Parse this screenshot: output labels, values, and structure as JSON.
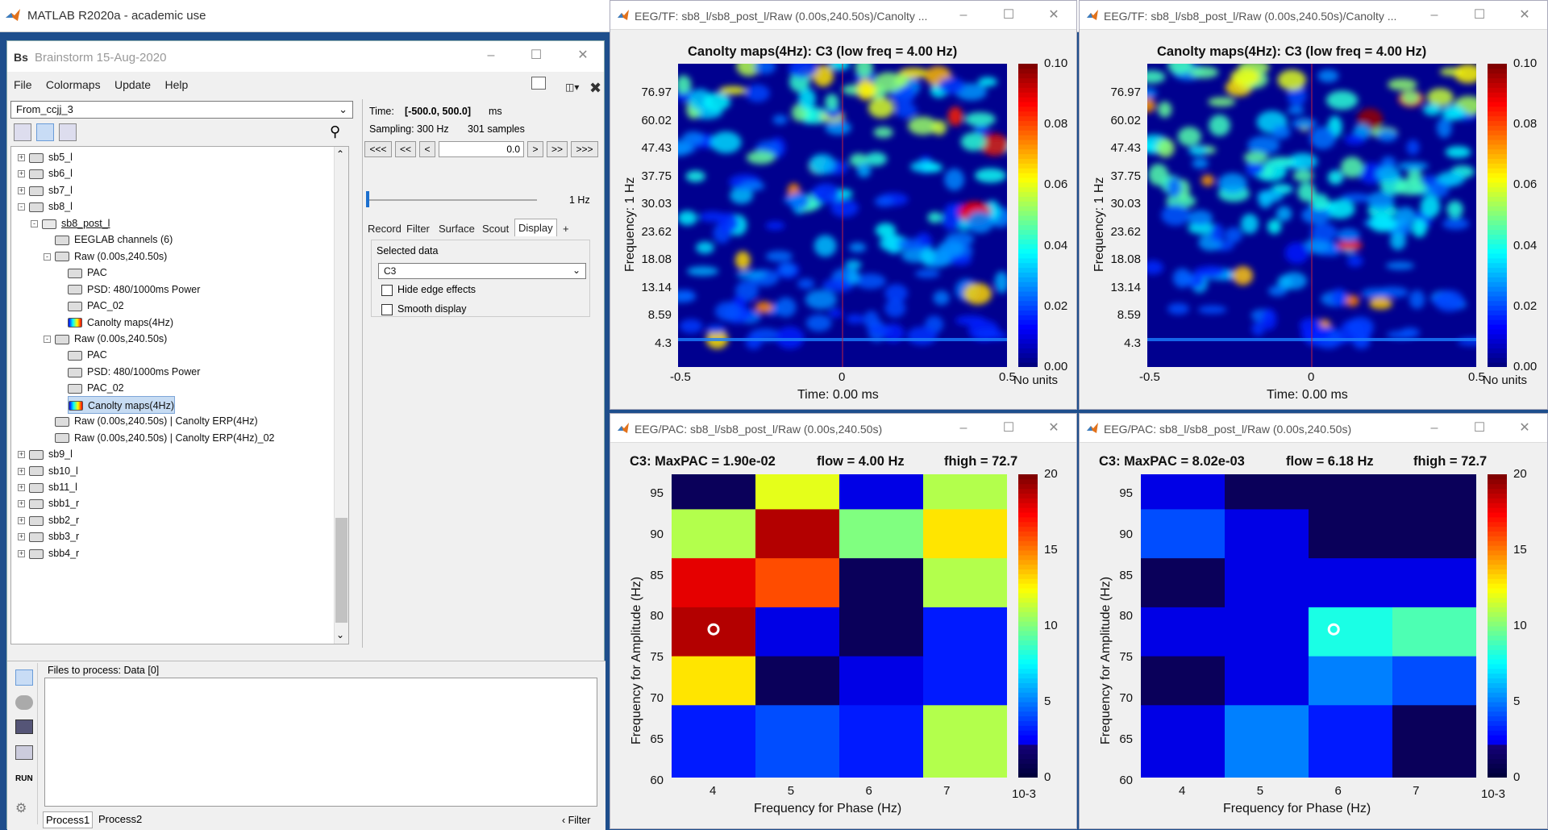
{
  "matlab_title": "MATLAB R2020a - academic use",
  "bst": {
    "title": "Brainstorm 15-Aug-2020",
    "menu": [
      "File",
      "Colormaps",
      "Update",
      "Help"
    ],
    "protocol": "From_ccjj_3",
    "tree": [
      {
        "label": "sb5_l",
        "level": 0,
        "exp": "+"
      },
      {
        "label": "sb6_l",
        "level": 0,
        "exp": "+"
      },
      {
        "label": "sb7_l",
        "level": 0,
        "exp": "+"
      },
      {
        "label": "sb8_l",
        "level": 0,
        "exp": "-"
      },
      {
        "label": "sb8_post_l",
        "level": 1,
        "exp": "-"
      },
      {
        "label": "EEGLAB channels (6)",
        "level": 2,
        "exp": ""
      },
      {
        "label": "Raw (0.00s,240.50s)",
        "level": 2,
        "exp": "-"
      },
      {
        "label": "PAC",
        "level": 3,
        "exp": ""
      },
      {
        "label": "PSD: 480/1000ms Power",
        "level": 3,
        "exp": ""
      },
      {
        "label": "PAC_02",
        "level": 3,
        "exp": ""
      },
      {
        "label": "Canolty maps(4Hz)",
        "level": 3,
        "exp": ""
      },
      {
        "label": "Raw (0.00s,240.50s)",
        "level": 2,
        "exp": "-"
      },
      {
        "label": "PAC",
        "level": 3,
        "exp": ""
      },
      {
        "label": "PSD: 480/1000ms Power",
        "level": 3,
        "exp": ""
      },
      {
        "label": "PAC_02",
        "level": 3,
        "exp": ""
      },
      {
        "label": "Canolty maps(4Hz)",
        "level": 3,
        "exp": "",
        "selected": true
      },
      {
        "label": "Raw (0.00s,240.50s) | Canolty ERP(4Hz)",
        "level": 2,
        "exp": ""
      },
      {
        "label": "Raw (0.00s,240.50s) | Canolty ERP(4Hz)_02",
        "level": 2,
        "exp": ""
      },
      {
        "label": "sb9_l",
        "level": 0,
        "exp": "+"
      },
      {
        "label": "sb10_l",
        "level": 0,
        "exp": "+"
      },
      {
        "label": "sb11_l",
        "level": 0,
        "exp": "+"
      },
      {
        "label": "sbb1_r",
        "level": 0,
        "exp": "+"
      },
      {
        "label": "sbb2_r",
        "level": 0,
        "exp": "+"
      },
      {
        "label": "sbb3_r",
        "level": 0,
        "exp": "+"
      },
      {
        "label": "sbb4_r",
        "level": 0,
        "exp": "+"
      }
    ],
    "time_label": "Time:",
    "time_value": "[-500.0, 500.0]",
    "time_unit": "ms",
    "sampling_label": "Sampling: 300 Hz",
    "samples_label": "301 samples",
    "nav": [
      "<<<",
      "<<",
      "<",
      ">",
      ">>",
      ">>>"
    ],
    "time_field": "0.0",
    "freq_label": "1 Hz",
    "tabs": [
      "Record",
      "Filter",
      "Surface",
      "Scout",
      "Display",
      "+"
    ],
    "selected_data_label": "Selected data",
    "channel": "C3",
    "hide_edge": "Hide edge effects",
    "smooth": "Smooth display",
    "files_to_process": "Files to process: Data [0]",
    "run": "RUN",
    "process_tabs": [
      "Process1",
      "Process2"
    ],
    "filter": "Filter"
  },
  "figs": [
    {
      "window_title": "EEG/TF: sb8_l/sb8_post_l/Raw (0.00s,240.50s)/Canolty ...",
      "title": "Canolty maps(4Hz):  C3    (low freq = 4.00 Hz)",
      "ylabel": "Frequency: 1 Hz",
      "xlabel": "Time: 0.00 ms",
      "yticks": [
        "76.97",
        "60.02",
        "47.43",
        "37.75",
        "30.03",
        "23.62",
        "18.08",
        "13.14",
        "8.59",
        "4.3"
      ],
      "xticks": [
        "-0.5",
        "0",
        "0.5"
      ],
      "cticks": [
        "0.10",
        "0.08",
        "0.06",
        "0.04",
        "0.02",
        "0.00"
      ],
      "unit": "No units"
    },
    {
      "window_title": "EEG/TF: sb8_l/sb8_post_l/Raw (0.00s,240.50s)/Canolty ...",
      "title": "Canolty maps(4Hz):  C3    (low freq = 4.00 Hz)",
      "ylabel": "Frequency: 1 Hz",
      "xlabel": "Time: 0.00 ms",
      "yticks": [
        "76.97",
        "60.02",
        "47.43",
        "37.75",
        "30.03",
        "23.62",
        "18.08",
        "13.14",
        "8.59",
        "4.3"
      ],
      "xticks": [
        "-0.5",
        "0",
        "0.5"
      ],
      "cticks": [
        "0.10",
        "0.08",
        "0.06",
        "0.04",
        "0.02",
        "0.00"
      ],
      "unit": "No units"
    },
    {
      "window_title": "EEG/PAC: sb8_l/sb8_post_l/Raw (0.00s,240.50s)",
      "title_a": "C3: MaxPAC = 1.90e-02",
      "title_b": "flow = 4.00 Hz",
      "title_c": "fhigh = 72.7",
      "ylabel": "Frequency for Amplitude (Hz)",
      "xlabel": "Frequency for Phase (Hz)",
      "yticks": [
        "95",
        "90",
        "85",
        "80",
        "75",
        "70",
        "65",
        "60"
      ],
      "xticks": [
        "4",
        "5",
        "6",
        "7"
      ],
      "cticks": [
        "20",
        "15",
        "10",
        "5",
        "0"
      ],
      "cscale": "10-3"
    },
    {
      "window_title": "EEG/PAC: sb8_l/sb8_post_l/Raw (0.00s,240.50s)",
      "title_a": "C3: MaxPAC = 8.02e-03",
      "title_b": "flow = 6.18 Hz",
      "title_c": "fhigh = 72.7",
      "ylabel": "Frequency for Amplitude (Hz)",
      "xlabel": "Frequency for Phase (Hz)",
      "yticks": [
        "95",
        "90",
        "85",
        "80",
        "75",
        "70",
        "65",
        "60"
      ],
      "xticks": [
        "4",
        "5",
        "6",
        "7"
      ],
      "cticks": [
        "20",
        "15",
        "10",
        "5",
        "0"
      ],
      "cscale": "10-3"
    }
  ],
  "pac_a": [
    [
      1,
      12,
      2,
      11
    ],
    [
      11,
      19,
      10,
      13
    ],
    [
      18,
      16,
      1,
      11
    ],
    [
      19,
      2,
      1,
      3
    ],
    [
      13,
      1,
      2,
      3
    ],
    [
      3,
      4,
      3,
      11
    ]
  ],
  "pac_b": [
    [
      2,
      1,
      1,
      1
    ],
    [
      4,
      2,
      1,
      1
    ],
    [
      1,
      2,
      2,
      2
    ],
    [
      2,
      2,
      8,
      9
    ],
    [
      1,
      2,
      5,
      4
    ],
    [
      2,
      5,
      3,
      1
    ]
  ]
}
